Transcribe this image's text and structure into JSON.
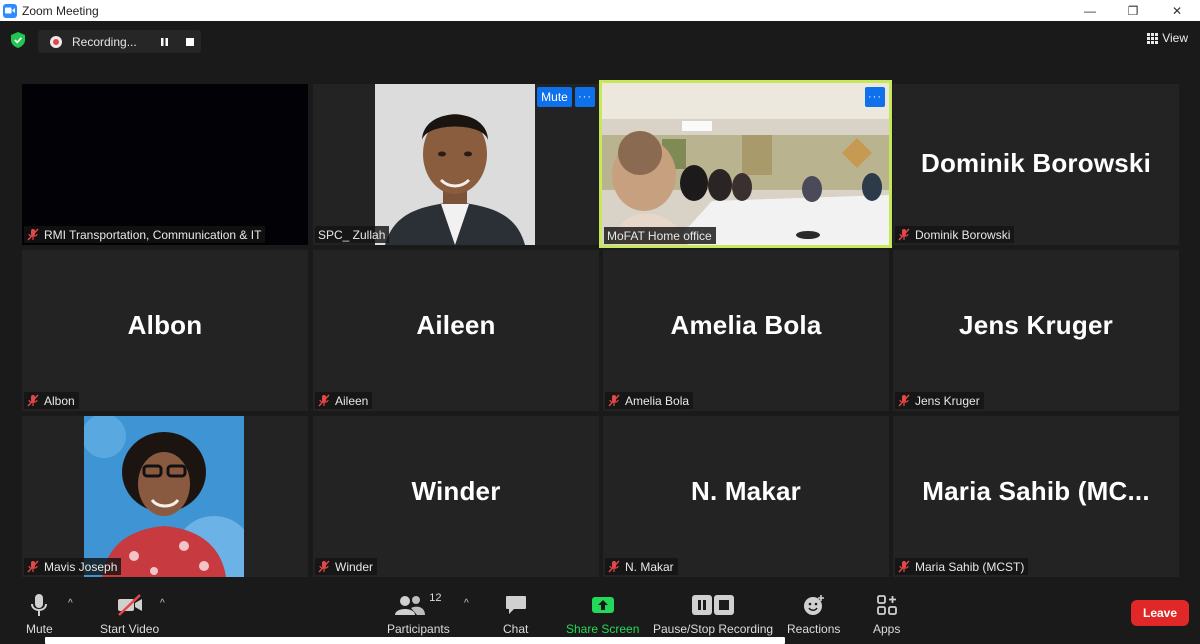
{
  "window": {
    "title": "Zoom Meeting",
    "minimize": "—",
    "maximize": "❐",
    "close": "✕"
  },
  "recording": {
    "status": "Recording..."
  },
  "view": {
    "label": "View"
  },
  "tiles": [
    {
      "name": "RMI Transportation, Communication & IT",
      "big": ""
    },
    {
      "name": "SPC_ Zullah",
      "big": ""
    },
    {
      "name": "MoFAT Home office",
      "big": ""
    },
    {
      "name": "Dominik Borowski",
      "big": "Dominik Borowski"
    },
    {
      "name": "Albon",
      "big": "Albon"
    },
    {
      "name": "Aileen",
      "big": "Aileen"
    },
    {
      "name": "Amelia Bola",
      "big": "Amelia Bola"
    },
    {
      "name": "Jens Kruger",
      "big": "Jens Kruger"
    },
    {
      "name": "Mavis Joseph",
      "big": ""
    },
    {
      "name": "Winder",
      "big": "Winder"
    },
    {
      "name": "N. Makar",
      "big": "N. Makar"
    },
    {
      "name": "Maria Sahib (MCST)",
      "big": "Maria  Sahib  (MC..."
    }
  ],
  "tile_buttons": {
    "mute": "Mute",
    "more": "···"
  },
  "toolbar": {
    "mute": "Mute",
    "start_video": "Start Video",
    "participants": "Participants",
    "participants_count": "12",
    "chat": "Chat",
    "share_screen": "Share Screen",
    "pause_stop_recording": "Pause/Stop Recording",
    "reactions": "Reactions",
    "apps": "Apps",
    "leave": "Leave"
  },
  "colors": {
    "accent": "#0e71eb",
    "share_green": "#23d959",
    "leave_red": "#e02828",
    "active_speaker": "#c7e85a"
  }
}
